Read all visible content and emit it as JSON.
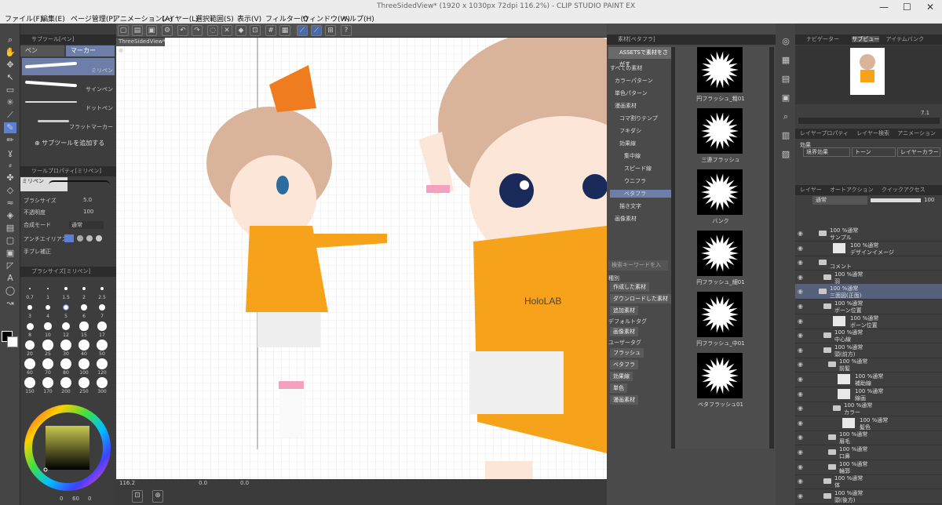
{
  "app": {
    "title": "ThreeSidedView* (1920 x 1030px 72dpi 116.2%) - CLIP STUDIO PAINT EX",
    "menus": [
      "ファイル(F)",
      "編集(E)",
      "ページ管理(P)",
      "アニメーション(A)",
      "レイヤー(L)",
      "選択範囲(S)",
      "表示(V)",
      "フィルター(I)",
      "ウィンドウ(W)",
      "ヘルプ(H)"
    ]
  },
  "canvas": {
    "tab": "ThreeSidedView*",
    "zoom": "116.2",
    "coord1": "0.0",
    "coord2": "0.0",
    "shirt_text": "HoloLAB"
  },
  "subtool": {
    "header": "サブツール[ペン]",
    "tabs": [
      "ペン",
      "マーカー"
    ],
    "brushes": [
      "ミリペン",
      "サインペン",
      "ドットペン",
      "フラットマーカー"
    ],
    "add_label": "サブツールを追加する"
  },
  "toolprop": {
    "header": "ツールプロパティ[ミリペン]",
    "name": "ミリペン",
    "size_label": "ブラシサイズ",
    "size_value": "5.0",
    "opacity_label": "不透明度",
    "opacity_value": "100",
    "blend_label": "合成モード",
    "blend_value": "通常",
    "aa_label": "アンチエイリアス",
    "correction_label": "手ブレ補正"
  },
  "brushsize": {
    "header": "ブラシサイズ[ミリペン]",
    "values": [
      "0.7",
      "1",
      "1.5",
      "2",
      "2.5",
      "3",
      "4",
      "5",
      "6",
      "7",
      "8",
      "10",
      "12",
      "15",
      "17",
      "20",
      "25",
      "30",
      "40",
      "50",
      "60",
      "70",
      "80",
      "100",
      "120",
      "150",
      "170",
      "200",
      "250",
      "300"
    ]
  },
  "colorwheel": {
    "values": [
      "0",
      "60",
      "0"
    ]
  },
  "material": {
    "header": "素材[ベタフラ]",
    "assets_button": "ASSETSで素材をさがす",
    "tree": [
      "すべての素材",
      "カラーパターン",
      "単色パターン",
      "漫画素材",
      "コマ割りテンプ",
      "フキダシ",
      "効果線",
      "集中線",
      "スピード線",
      "ウニフラ",
      "ベタフラ",
      "描き文字",
      "画像素材"
    ],
    "search_placeholder": "検索キーワードを入",
    "section_kind": "種別",
    "kind_tags": [
      "作成した素材",
      "ダウンロードした素材",
      "追加素材"
    ],
    "section_default": "デフォルトタグ",
    "default_tags": [
      "画像素材"
    ],
    "section_user": "ユーザータグ",
    "user_tags": [
      "フラッシュ",
      "ベタフラ",
      "効果線",
      "単色",
      "漫画素材"
    ],
    "items": [
      "円フラッシュ_粗01",
      "三連フラッシュ",
      "バンク",
      "円フラッシュ_細01",
      "円フラッシュ_中01",
      "ベタフラッシュ01"
    ]
  },
  "navigator": {
    "tabs": [
      "ナビゲーター",
      "サブビュー",
      "アイテムバンク"
    ],
    "value": "7.1"
  },
  "layerprop": {
    "tabs": [
      "レイヤープロパティ",
      "レイヤー検索",
      "アニメーション"
    ],
    "effect_label": "効果",
    "effects": [
      "境界効果",
      "トーン",
      "レイヤーカラー"
    ]
  },
  "layers": {
    "tabs": [
      "レイヤー",
      "オートアクション",
      "クイックアクセス"
    ],
    "blend": "通常",
    "opacity": "100",
    "rows": [
      {
        "l1": "100 %通常",
        "l2": "サンプル",
        "indent": 2,
        "folder": true
      },
      {
        "l1": "100 %通常",
        "l2": "デザインイメージ",
        "indent": 5,
        "folder": false
      },
      {
        "l1": "",
        "l2": "コメント",
        "indent": 2,
        "folder": true
      },
      {
        "l1": "100 %通常",
        "l2": "羽",
        "indent": 3,
        "folder": true
      },
      {
        "l1": "100 %通常",
        "l2": "三面図(正面)",
        "indent": 2,
        "folder": true,
        "selected": true
      },
      {
        "l1": "100 %通常",
        "l2": "ボーン位置",
        "indent": 3,
        "folder": true
      },
      {
        "l1": "100 %通常",
        "l2": "ボーン位置",
        "indent": 5,
        "folder": false
      },
      {
        "l1": "100 %通常",
        "l2": "中心線",
        "indent": 3,
        "folder": true
      },
      {
        "l1": "100 %通常",
        "l2": "頭(前方)",
        "indent": 3,
        "folder": true
      },
      {
        "l1": "100 %通常",
        "l2": "前髪",
        "indent": 4,
        "folder": true
      },
      {
        "l1": "100 %通常",
        "l2": "補助線",
        "indent": 6,
        "folder": false
      },
      {
        "l1": "100 %通常",
        "l2": "線画",
        "indent": 6,
        "folder": false
      },
      {
        "l1": "100 %通常",
        "l2": "カラー",
        "indent": 5,
        "folder": true
      },
      {
        "l1": "100 %通常",
        "l2": "髪色",
        "indent": 7,
        "folder": false
      },
      {
        "l1": "100 %通常",
        "l2": "眉毛",
        "indent": 4,
        "folder": true
      },
      {
        "l1": "100 %通常",
        "l2": "口鼻",
        "indent": 4,
        "folder": true
      },
      {
        "l1": "100 %通常",
        "l2": "輪郭",
        "indent": 4,
        "folder": true
      },
      {
        "l1": "100 %通常",
        "l2": "体",
        "indent": 3,
        "folder": true
      },
      {
        "l1": "100 %通常",
        "l2": "頭(後方)",
        "indent": 3,
        "folder": true
      }
    ]
  },
  "colors": {
    "accent": "#5b7fd1",
    "shirt": "#f7a21b",
    "hair": "#d9b39a",
    "selected_layer": "#55617a"
  }
}
